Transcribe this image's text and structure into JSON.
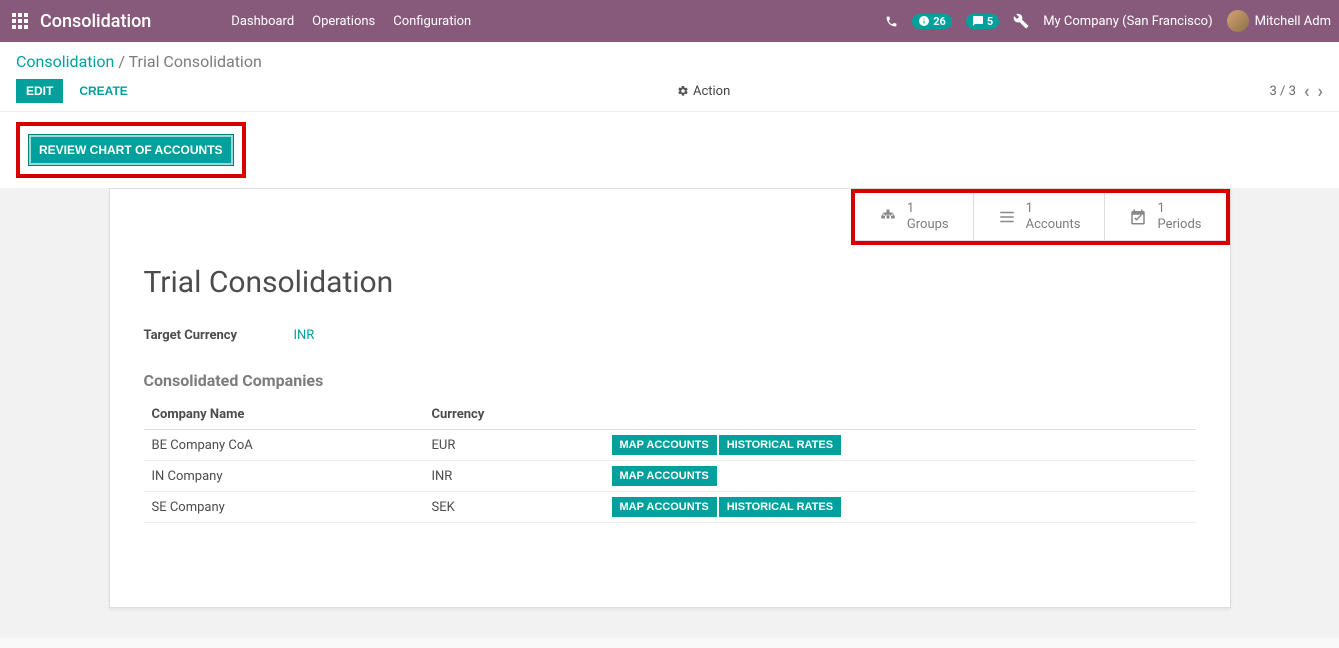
{
  "navbar": {
    "brand": "Consolidation",
    "menu": [
      "Dashboard",
      "Operations",
      "Configuration"
    ],
    "badge1": "26",
    "badge2": "5",
    "company": "My Company (San Francisco)",
    "user": "Mitchell Adm"
  },
  "breadcrumb": {
    "root": "Consolidation",
    "sep": " / ",
    "current": "Trial Consolidation"
  },
  "controls": {
    "edit": "Edit",
    "create": "Create",
    "action": "Action",
    "pager": "3 / 3",
    "review_btn": "Review Chart of Accounts"
  },
  "stats": {
    "groups_count": "1",
    "groups_label": "Groups",
    "accounts_count": "1",
    "accounts_label": "Accounts",
    "periods_count": "1",
    "periods_label": "Periods"
  },
  "form": {
    "title": "Trial Consolidation",
    "target_currency_label": "Target Currency",
    "target_currency_value": "INR",
    "section_title": "Consolidated Companies",
    "columns": {
      "company": "Company Name",
      "currency": "Currency"
    },
    "map_label": "Map Accounts",
    "hist_label": "Historical Rates",
    "rows": [
      {
        "company": "BE Company CoA",
        "currency": "EUR",
        "historical": true
      },
      {
        "company": "IN Company",
        "currency": "INR",
        "historical": false
      },
      {
        "company": "SE Company",
        "currency": "SEK",
        "historical": true
      }
    ]
  }
}
